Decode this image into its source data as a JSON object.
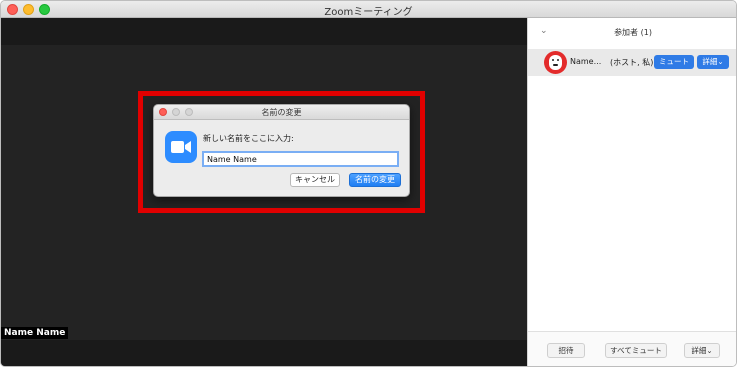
{
  "window": {
    "title": "Zoomミーティング"
  },
  "video": {
    "name_label": "Name Name"
  },
  "dialog": {
    "title": "名前の変更",
    "prompt": "新しい名前をここに入力:",
    "input_value": "Name Name",
    "cancel_label": "キャンセル",
    "rename_label": "名前の変更"
  },
  "panel": {
    "title": "参加者 (1)",
    "participants": [
      {
        "name": "Name...",
        "role": "(ホスト, 私)",
        "mute_label": "ミュート",
        "more_label": "詳細"
      }
    ],
    "footer": {
      "invite_label": "招待",
      "mute_all_label": "すべてミュート",
      "more_label": "詳細"
    }
  },
  "colors": {
    "accent": "#2f7be6",
    "highlight": "#e10000",
    "video_bg": "#232323"
  },
  "icons": [
    "zoom-camera-icon",
    "collapse-chevron-icon",
    "chevron-down-icon"
  ]
}
